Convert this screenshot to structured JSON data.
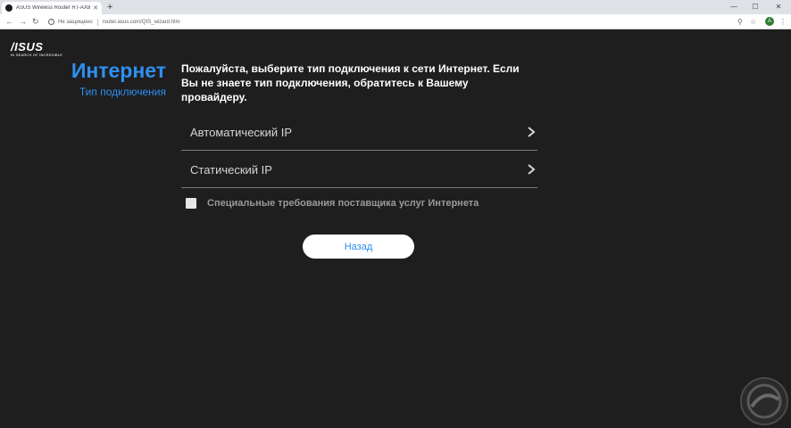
{
  "browser": {
    "tab_title": "ASUS Wireless Router RT-AX86U",
    "insecure_label": "Не защищено",
    "url": "router.asus.com/QIS_wizard.htm",
    "profile_initial": "A"
  },
  "logo": {
    "brand": "/ISUS",
    "tagline": "IN SEARCH OF INCREDIBLE"
  },
  "sidebar": {
    "title": "Интернет",
    "subtitle": "Тип подключения"
  },
  "main": {
    "prompt": "Пожалуйста, выберите тип подключения к сети Интернет. Если Вы не знаете тип подключения, обратитесь к Вашему провайдеру.",
    "options": [
      {
        "label": "Автоматический IP"
      },
      {
        "label": "Статический IP"
      }
    ],
    "special_requirements_label": "Специальные требования поставщика услуг Интернета",
    "back_label": "Назад"
  },
  "colors": {
    "accent": "#2f8ff0",
    "background": "#1e1e1e"
  }
}
